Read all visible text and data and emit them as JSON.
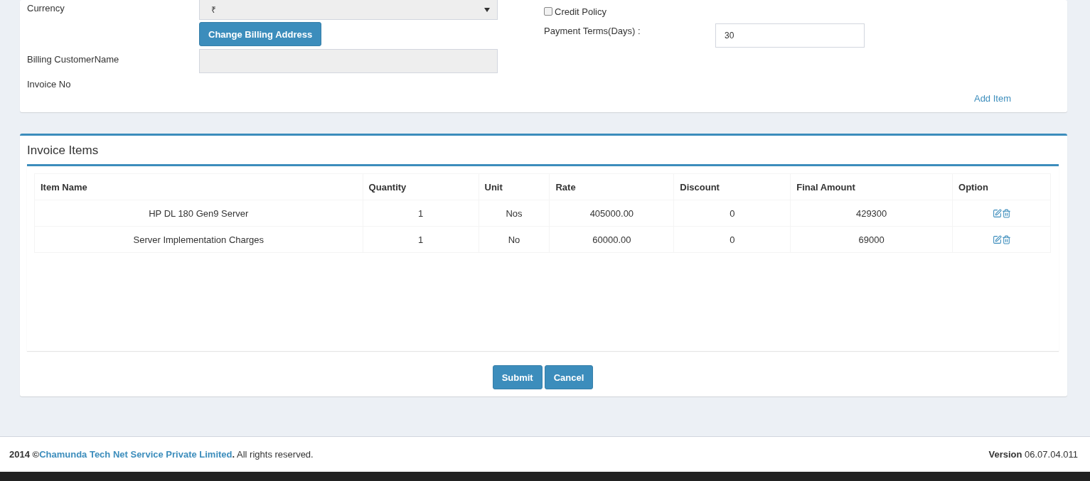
{
  "billing_form": {
    "currency": {
      "label": "Currency",
      "value": "₹"
    },
    "change_billing_button": "Change Billing Address",
    "billing_customer_name": {
      "label": "Billing CustomerName"
    },
    "invoice_no": {
      "label": "Invoice No"
    },
    "credit_policy": {
      "label": "Credit Policy",
      "checked": false
    },
    "payment_terms": {
      "label": "Payment Terms(Days) :",
      "value": "30"
    },
    "add_item_link": "Add Item"
  },
  "invoice_items": {
    "title": "Invoice Items",
    "columns": [
      "Item Name",
      "Quantity",
      "Unit",
      "Rate",
      "Discount",
      "Final Amount",
      "Option"
    ],
    "rows": [
      {
        "item_name": "HP DL 180 Gen9 Server",
        "quantity": "1",
        "unit": "Nos",
        "rate": "405000.00",
        "discount": "0",
        "final_amount": "429300"
      },
      {
        "item_name": "Server Implementation Charges",
        "quantity": "1",
        "unit": "No",
        "rate": "60000.00",
        "discount": "0",
        "final_amount": "69000"
      }
    ],
    "buttons": [
      "Submit",
      "Cancel"
    ]
  },
  "footer": {
    "prefix": "**2014 ©**",
    "company": "Chamunda Tech Net Service Private Limited",
    "suffix": "**.** All rights reserved.",
    "version": "**Version** 06.07.04.011"
  }
}
